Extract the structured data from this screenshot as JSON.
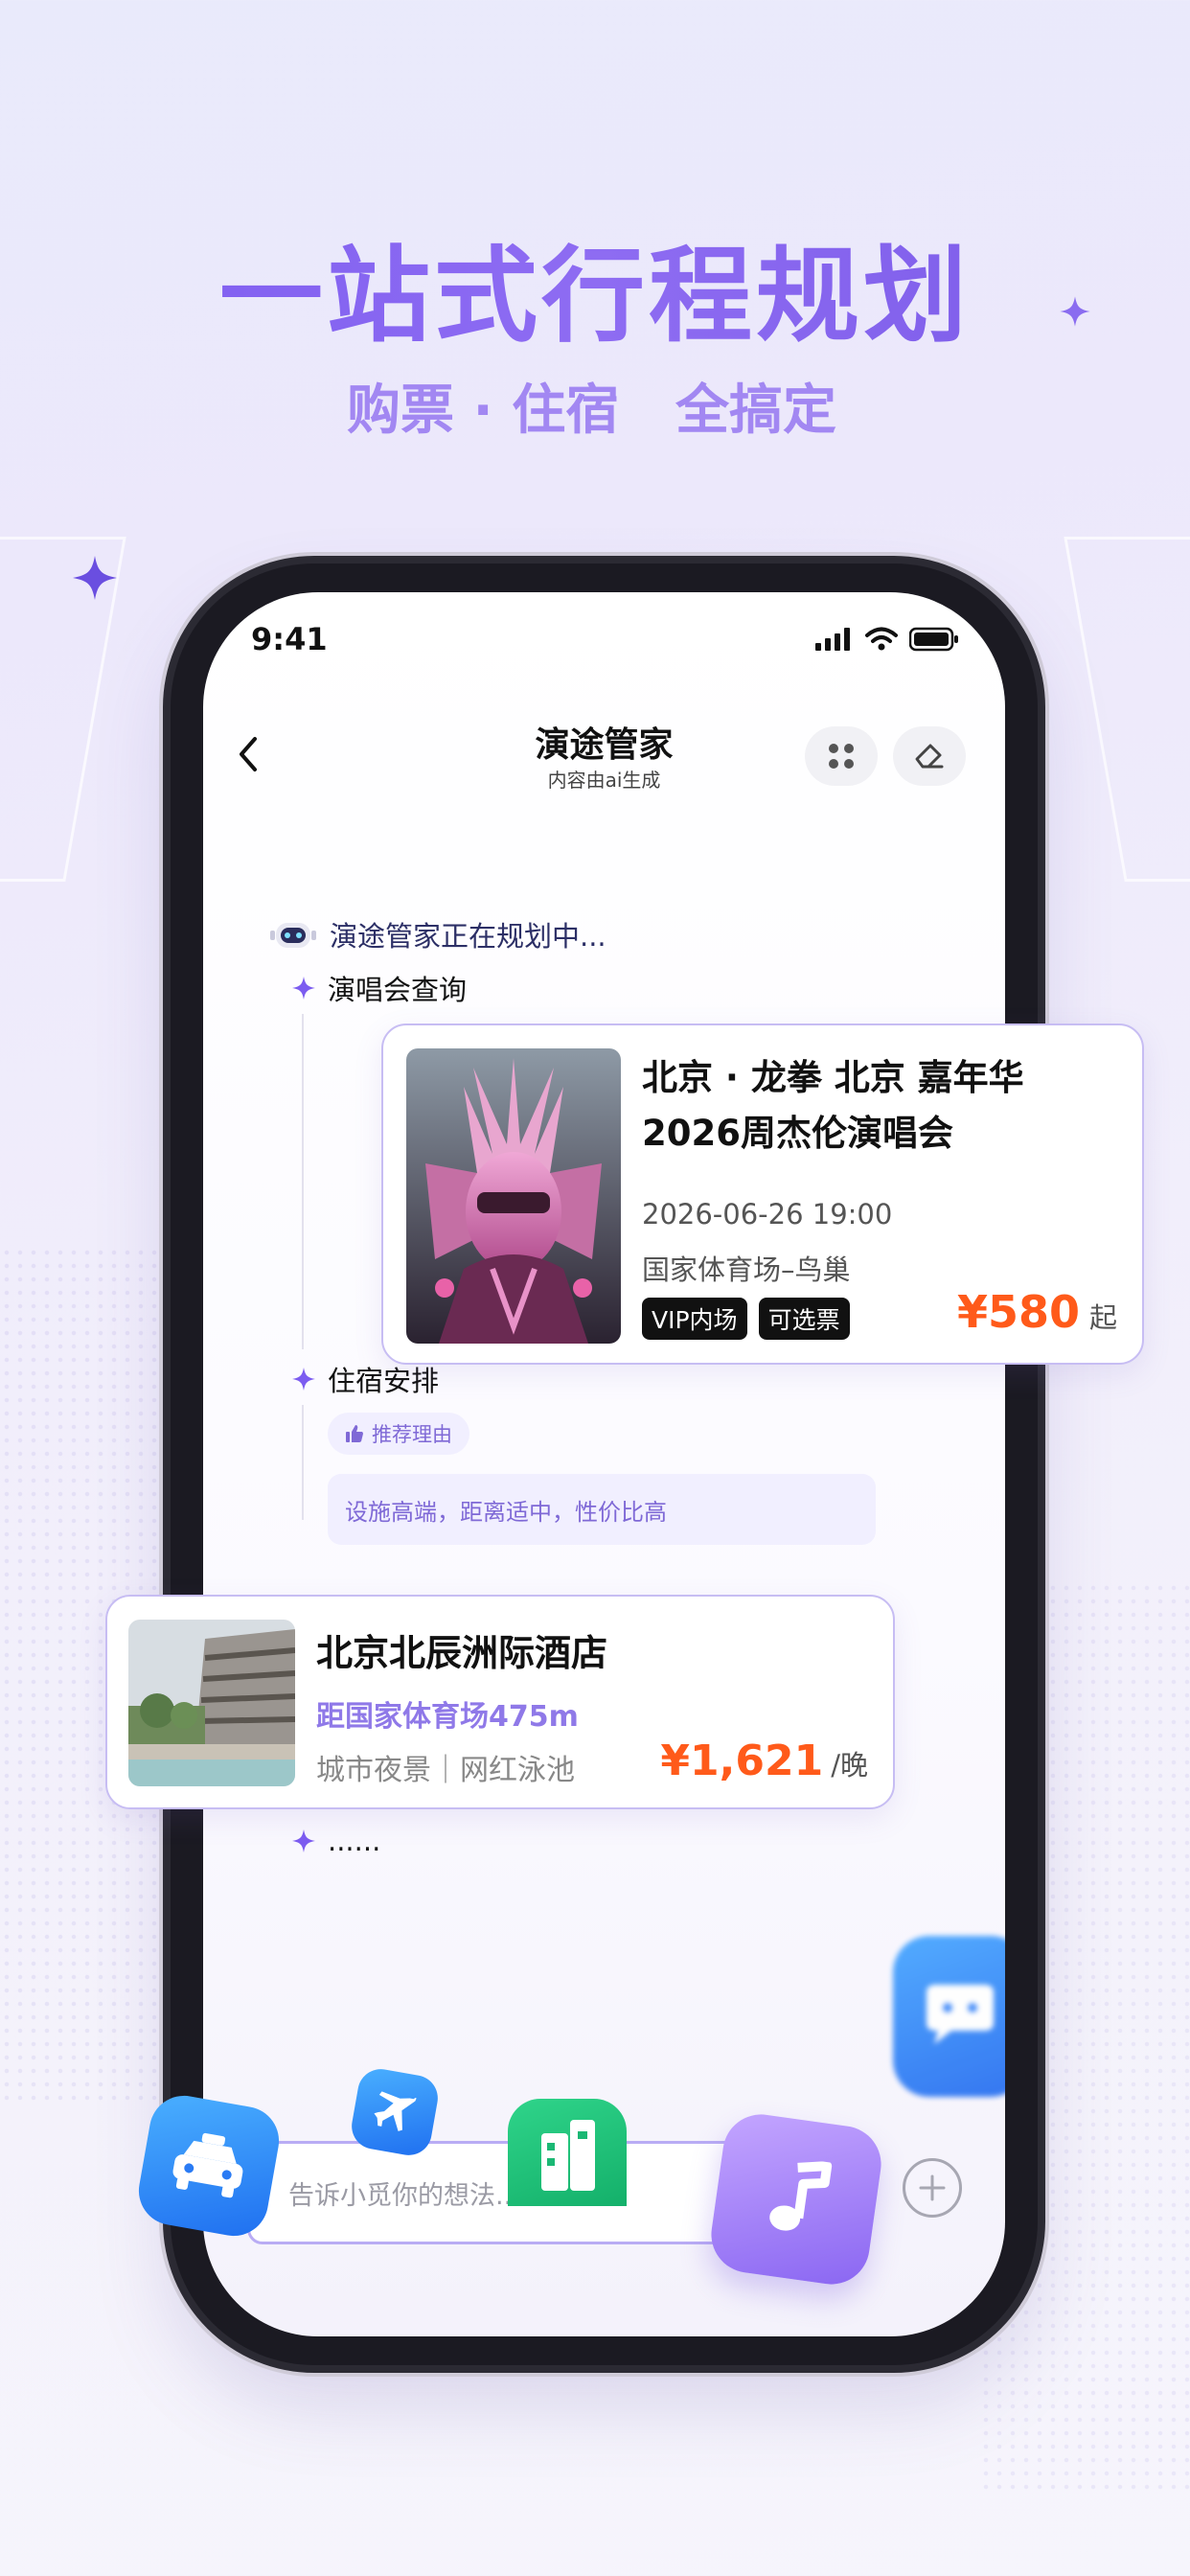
{
  "hero": {
    "title": "一站式行程规划",
    "subtitle_left": "购票 · 住宿",
    "subtitle_right": "全搞定"
  },
  "status_bar": {
    "time": "9:41"
  },
  "nav": {
    "title": "演途管家",
    "subtitle": "内容由ai生成"
  },
  "assistant": {
    "status_text": "演途管家正在规划中..."
  },
  "sections": {
    "concert_query": "演唱会查询",
    "lodging": "住宿安排",
    "more": "......"
  },
  "concert": {
    "title": "北京 · 龙拳 北京 嘉年华 2026周杰伦演唱会",
    "datetime": "2026-06-26 19:00",
    "venue": "国家体育场–鸟巢",
    "tags": [
      "VIP内场",
      "可选票"
    ],
    "price": "¥580",
    "price_suffix": "起"
  },
  "recommend": {
    "tag": "推荐理由",
    "reason": "设施高端，距离适中，性价比高"
  },
  "hotel": {
    "name": "北京北辰洲际酒店",
    "distance": "距国家体育场475m",
    "tags": "城市夜景｜网红泳池",
    "price": "¥1,621",
    "price_suffix": "/晚"
  },
  "input": {
    "placeholder": "告诉小觅你的想法..."
  },
  "colors": {
    "brand": "#7c5cf0",
    "price": "#ff5a1a",
    "border": "#c7bdf3"
  }
}
